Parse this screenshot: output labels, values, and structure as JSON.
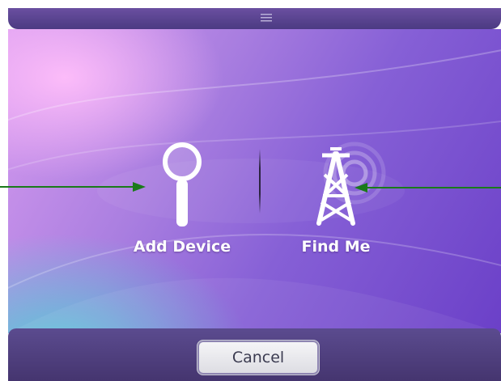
{
  "dialog": {
    "handle_icon": "menu-handle-icon",
    "actions": [
      {
        "label": "Add Device",
        "icon": "magnifier-icon"
      },
      {
        "label": "Find Me",
        "icon": "radio-tower-icon"
      }
    ],
    "cancel_label": "Cancel"
  },
  "annotations": {
    "arrow_color": "#1a7a1a",
    "arrows": [
      "arrow-to-add-device",
      "arrow-to-find-me"
    ]
  },
  "colors": {
    "panel_pink": "#d79bef",
    "panel_violet": "#6b40c8",
    "panel_teal": "#5acdd7",
    "bar_purple": "#4b3a82"
  }
}
